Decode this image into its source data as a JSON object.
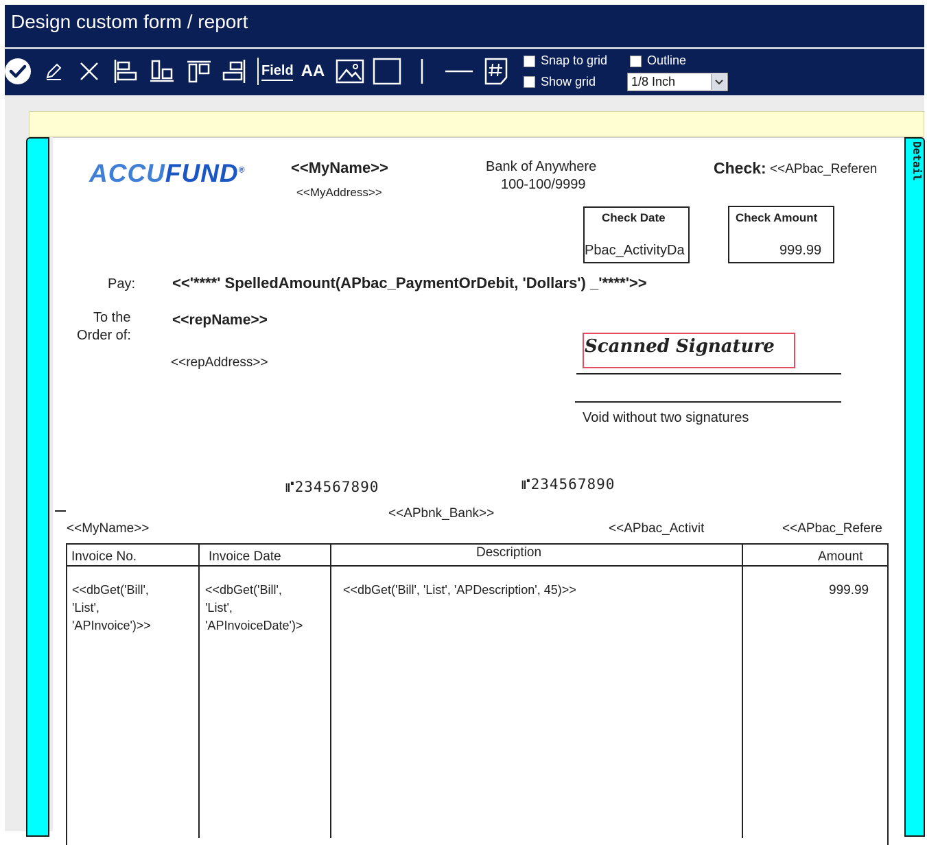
{
  "window": {
    "title": "Design custom form / report"
  },
  "toolbar": {
    "icons": [
      "accept-icon",
      "edit-pencil-icon",
      "close-x-icon",
      "align-left-icon",
      "align-bottom-icon",
      "align-top-icon",
      "align-right-icon",
      "field-icon",
      "text-font-icon",
      "image-icon",
      "rectangle-icon",
      "vertical-line-icon",
      "horizontal-line-icon",
      "page-number-icon"
    ],
    "field_label": "Field",
    "text_label": "AA",
    "snap_to_grid": {
      "label": "Snap to grid",
      "checked": false
    },
    "show_grid": {
      "label": "Show grid",
      "checked": false
    },
    "outline": {
      "label": "Outline",
      "checked": false
    },
    "grid_size": {
      "value": "1/8 Inch"
    }
  },
  "colors": {
    "title_bar": "#0a1f55",
    "band": "#00ffff",
    "header_band": "#fffed2",
    "signature_box": "#e84a5f",
    "logo": "#1a56c4"
  },
  "section": {
    "detail_label": "Detail"
  },
  "check": {
    "logo_part1": "ACCU",
    "logo_part2": "FUND",
    "logo_mark": "®",
    "my_name": "<<MyName>>",
    "my_address": "<<MyAddress>>",
    "bank_name": "Bank of Anywhere",
    "bank_routing": "100-100/9999",
    "check_label": "Check:",
    "check_ref": "<<APbac_Referen",
    "check_date_label": "Check Date",
    "check_date_value": "Pbac_ActivityDa",
    "check_amount_label": "Check Amount",
    "check_amount_value": "999.99",
    "pay_label": "Pay:",
    "spelled_amount": "<<'****'  SpelledAmount(APbac_PaymentOrDebit, 'Dollars') _'****'>>",
    "to_order_line1": "To the",
    "to_order_line2": "Order of:",
    "rep_name": "<<repName>>",
    "rep_address": "<<repAddress>>",
    "signature_text": "Scanned Signature",
    "void_text": "Void without two signatures",
    "micr_1": "⑈234567890",
    "micr_2": "⑈234567890"
  },
  "stub": {
    "bank": "<<APbnk_Bank>>",
    "my_name": "<<MyName>>",
    "activity": "<<APbac_Activit",
    "reference": "<<APbac_Refere",
    "columns": [
      "Invoice No.",
      "Invoice Date",
      "Description",
      "Amount"
    ],
    "row": {
      "invoice_no": [
        "<<dbGet('Bill',",
        "'List',",
        "'APInvoice')>>"
      ],
      "invoice_date": [
        "<<dbGet('Bill',",
        "'List',",
        "'APInvoiceDate')>"
      ],
      "description": "<<dbGet('Bill', 'List', 'APDescription', 45)>>",
      "amount": "999.99"
    }
  }
}
